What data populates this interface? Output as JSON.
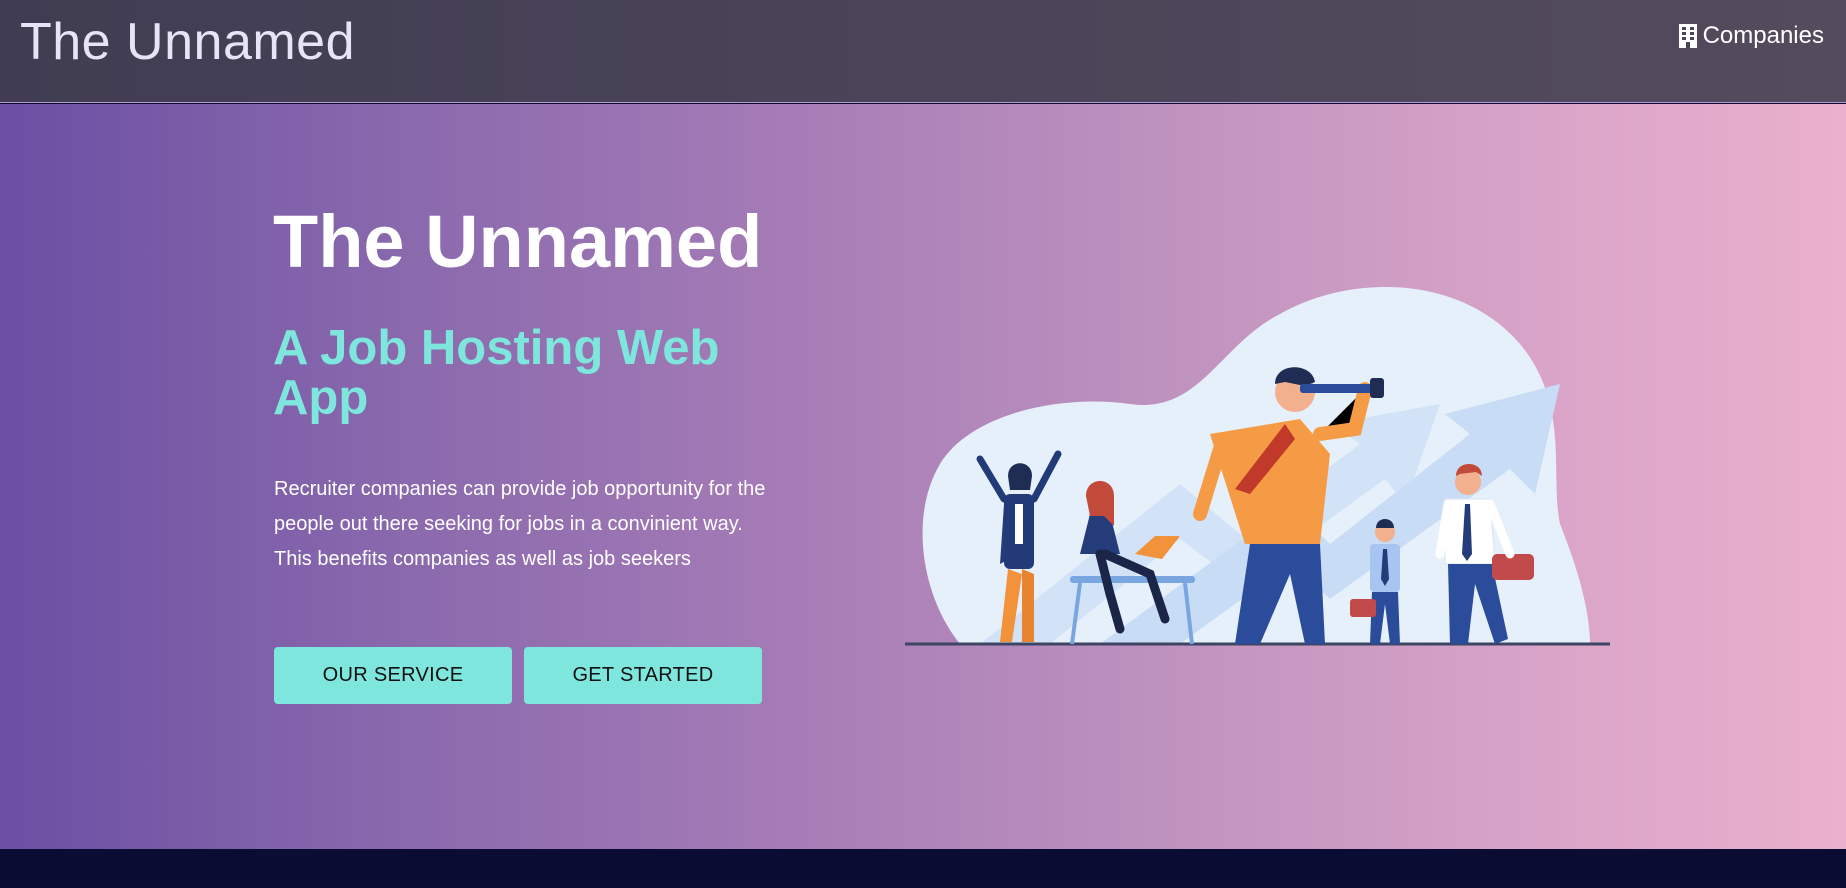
{
  "navbar": {
    "brand": "The Unnamed",
    "companies_link": "Companies",
    "companies_icon": "building-icon"
  },
  "hero": {
    "title": "The Unnamed",
    "subtitle": "A Job Hosting Web App",
    "description": "Recruiter companies can provide job opportunity for the people out there seeking for jobs in a convinient way. This benefits companies as well as job seekers",
    "buttons": {
      "service": "OUR SERVICE",
      "get_started": "GET STARTED"
    },
    "illustration": "people-career-growth-illustration"
  },
  "colors": {
    "accent": "#7fe6dd",
    "navbar": "#46414f",
    "gradient_start": "#6b4fa3",
    "gradient_end": "#eab0cc",
    "footer": "#0a0c33"
  }
}
